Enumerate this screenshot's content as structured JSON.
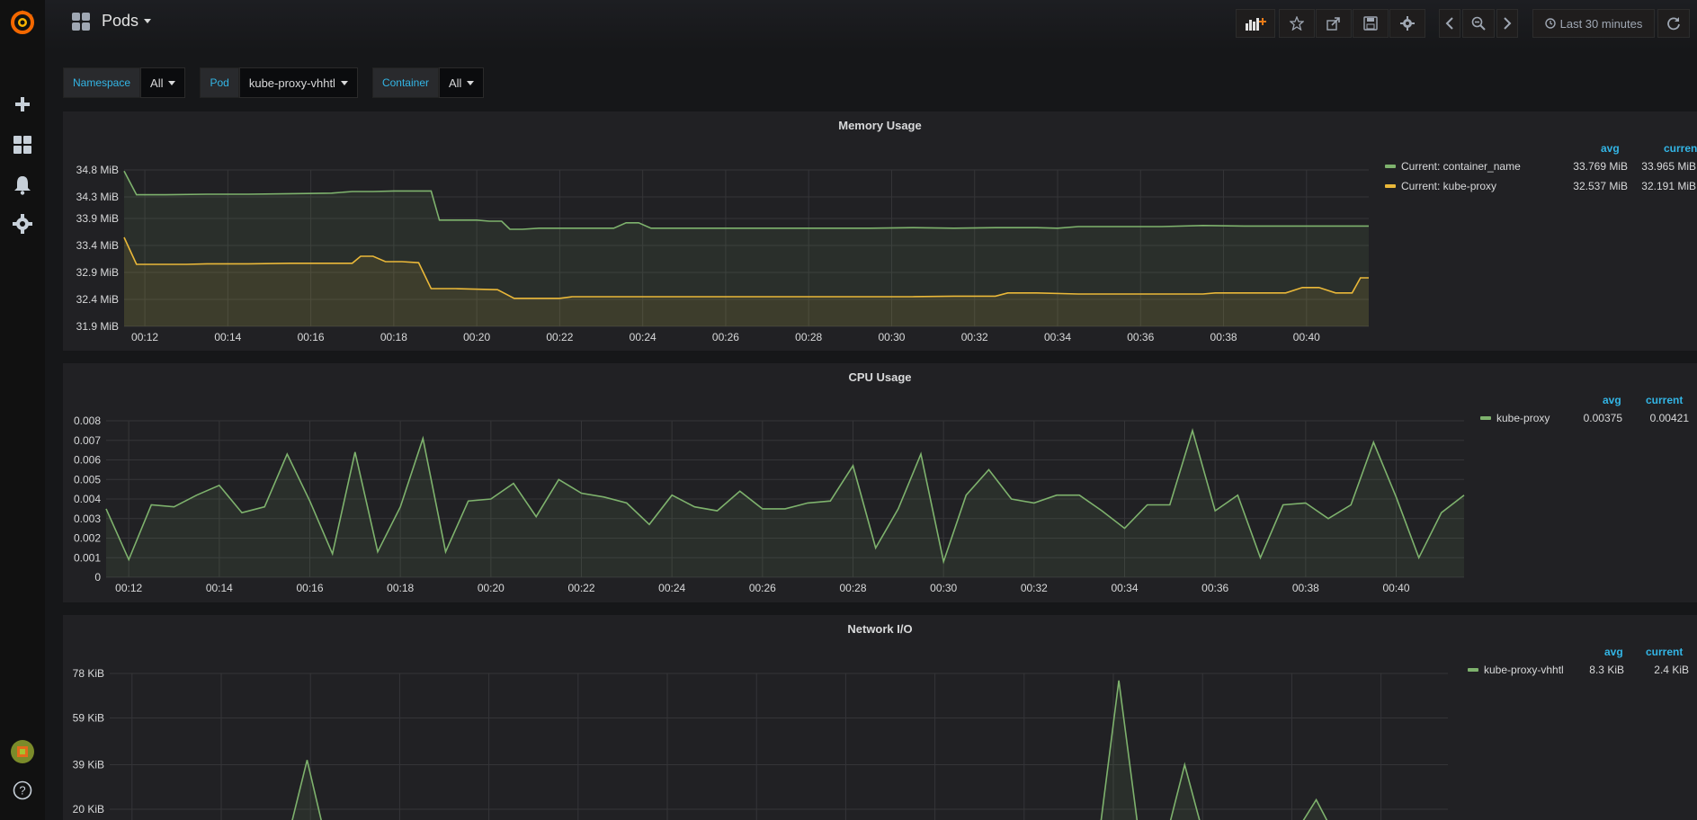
{
  "header": {
    "dashboard_title": "Pods",
    "time_range": "Last 30 minutes"
  },
  "toolbar": {
    "icons": [
      "add-panel-icon",
      "star-icon",
      "share-icon",
      "save-icon",
      "settings-icon",
      "chevron-left-icon",
      "zoom-out-icon",
      "chevron-right-icon",
      "clock-icon",
      "refresh-icon"
    ]
  },
  "sidebar": {
    "icons": [
      "grafana-logo-icon",
      "plus-icon",
      "dashboards-icon",
      "bell-icon",
      "gear-icon",
      "avatar",
      "help-icon"
    ]
  },
  "variables": [
    {
      "label": "Namespace",
      "value": "All"
    },
    {
      "label": "Pod",
      "value": "kube-proxy-vhhtl"
    },
    {
      "label": "Container",
      "value": "All"
    }
  ],
  "colors": {
    "green": "#7eb26d",
    "yellow": "#eab839",
    "accent": "#33b5e5",
    "panel_bg": "#212124",
    "page_bg": "#161719"
  },
  "chart_data": [
    {
      "type": "line",
      "title": "Memory Usage",
      "x_ticks": [
        "00:12",
        "00:14",
        "00:16",
        "00:18",
        "00:20",
        "00:22",
        "00:24",
        "00:26",
        "00:28",
        "00:30",
        "00:32",
        "00:34",
        "00:36",
        "00:38",
        "00:40"
      ],
      "y_ticks": [
        "31.9 MiB",
        "32.4 MiB",
        "32.9 MiB",
        "33.4 MiB",
        "33.9 MiB",
        "34.3 MiB",
        "34.8 MiB"
      ],
      "ylim": [
        31.9,
        34.8
      ],
      "x_range": [
        "00:11:30",
        "00:41:30"
      ],
      "legend_headers": {
        "avg": "avg",
        "current": "current"
      },
      "series": [
        {
          "name": "Current: container_name",
          "color": "#7eb26d",
          "avg": "33.769 MiB",
          "current": "33.965 MiB",
          "points": [
            [
              0,
              34.78
            ],
            [
              0.3,
              34.34
            ],
            [
              1,
              34.34
            ],
            [
              2,
              34.35
            ],
            [
              3,
              34.35
            ],
            [
              4,
              34.36
            ],
            [
              5,
              34.37
            ],
            [
              5.5,
              34.4
            ],
            [
              6,
              34.4
            ],
            [
              6.5,
              34.41
            ],
            [
              7,
              34.41
            ],
            [
              7.4,
              34.41
            ],
            [
              7.6,
              33.87
            ],
            [
              8.5,
              33.87
            ],
            [
              8.8,
              33.85
            ],
            [
              9.1,
              33.85
            ],
            [
              9.3,
              33.7
            ],
            [
              9.6,
              33.7
            ],
            [
              10,
              33.72
            ],
            [
              11,
              33.72
            ],
            [
              11.8,
              33.72
            ],
            [
              12.1,
              33.82
            ],
            [
              12.4,
              33.82
            ],
            [
              12.7,
              33.72
            ],
            [
              14,
              33.72
            ],
            [
              16,
              33.72
            ],
            [
              18,
              33.72
            ],
            [
              19,
              33.73
            ],
            [
              20,
              33.72
            ],
            [
              21,
              33.73
            ],
            [
              22,
              33.73
            ],
            [
              22.5,
              33.72
            ],
            [
              23,
              33.75
            ],
            [
              24,
              33.75
            ],
            [
              25,
              33.75
            ],
            [
              26,
              33.77
            ],
            [
              27,
              33.76
            ],
            [
              28,
              33.76
            ],
            [
              29,
              33.76
            ],
            [
              30,
              33.76
            ],
            [
              31,
              33.77
            ],
            [
              32,
              33.76
            ],
            [
              33,
              33.76
            ],
            [
              34,
              33.76
            ],
            [
              35,
              33.76
            ],
            [
              35.5,
              33.78
            ],
            [
              36,
              33.78
            ],
            [
              36.3,
              33.45
            ],
            [
              37,
              33.45
            ],
            [
              38,
              33.45
            ],
            [
              39,
              33.45
            ],
            [
              39.4,
              33.42
            ],
            [
              40,
              33.42
            ],
            [
              40.3,
              33.52
            ],
            [
              40.6,
              33.52
            ],
            [
              41,
              34.04
            ],
            [
              41.3,
              34.04
            ]
          ]
        },
        {
          "name": "Current: kube-proxy",
          "color": "#eab839",
          "avg": "32.537 MiB",
          "current": "32.191 MiB",
          "points": [
            [
              0,
              33.55
            ],
            [
              0.3,
              33.05
            ],
            [
              1,
              33.05
            ],
            [
              1.5,
              33.05
            ],
            [
              2,
              33.06
            ],
            [
              3,
              33.06
            ],
            [
              4,
              33.07
            ],
            [
              5,
              33.07
            ],
            [
              5.5,
              33.07
            ],
            [
              5.7,
              33.2
            ],
            [
              6,
              33.2
            ],
            [
              6.3,
              33.1
            ],
            [
              6.7,
              33.1
            ],
            [
              7.1,
              33.08
            ],
            [
              7.4,
              32.6
            ],
            [
              8,
              32.6
            ],
            [
              9,
              32.58
            ],
            [
              9.4,
              32.42
            ],
            [
              10,
              32.42
            ],
            [
              10.5,
              32.42
            ],
            [
              10.8,
              32.45
            ],
            [
              12,
              32.45
            ],
            [
              14,
              32.45
            ],
            [
              16,
              32.45
            ],
            [
              18,
              32.45
            ],
            [
              19,
              32.45
            ],
            [
              20,
              32.46
            ],
            [
              21,
              32.46
            ],
            [
              21.3,
              32.52
            ],
            [
              22,
              32.52
            ],
            [
              23,
              32.5
            ],
            [
              24,
              32.5
            ],
            [
              25,
              32.5
            ],
            [
              26,
              32.5
            ],
            [
              26.3,
              32.52
            ],
            [
              27,
              32.52
            ],
            [
              28,
              32.52
            ],
            [
              28.4,
              32.62
            ],
            [
              28.8,
              32.62
            ],
            [
              29.2,
              32.52
            ],
            [
              29.6,
              32.52
            ],
            [
              29.8,
              32.8
            ],
            [
              30.2,
              32.8
            ],
            [
              30.5,
              32.52
            ],
            [
              31,
              32.52
            ],
            [
              32,
              32.52
            ],
            [
              33,
              32.52
            ],
            [
              33.5,
              32.53
            ],
            [
              34,
              32.52
            ],
            [
              35,
              32.52
            ],
            [
              35.5,
              32.52
            ],
            [
              35.8,
              32.52
            ],
            [
              36.2,
              32.1
            ],
            [
              37,
              32.1
            ],
            [
              38,
              32.12
            ],
            [
              38.5,
              32.1
            ],
            [
              39,
              32.1
            ],
            [
              40,
              32.1
            ],
            [
              40.5,
              32.1
            ],
            [
              41,
              32.2
            ],
            [
              41.3,
              32.2
            ]
          ]
        }
      ]
    },
    {
      "type": "area",
      "title": "CPU Usage",
      "x_ticks": [
        "00:12",
        "00:14",
        "00:16",
        "00:18",
        "00:20",
        "00:22",
        "00:24",
        "00:26",
        "00:28",
        "00:30",
        "00:32",
        "00:34",
        "00:36",
        "00:38",
        "00:40"
      ],
      "y_ticks": [
        "0",
        "0.001",
        "0.002",
        "0.003",
        "0.004",
        "0.005",
        "0.006",
        "0.007",
        "0.008"
      ],
      "ylim": [
        0,
        0.008
      ],
      "x_range": [
        "00:11:30",
        "00:41:30"
      ],
      "legend_headers": {
        "avg": "avg",
        "current": "current"
      },
      "series": [
        {
          "name": "kube-proxy",
          "color": "#7eb26d",
          "avg": "0.00375",
          "current": "0.00421",
          "values": [
            0.0035,
            0.0009,
            0.0037,
            0.0036,
            0.0042,
            0.0047,
            0.0033,
            0.0036,
            0.0063,
            0.0039,
            0.0012,
            0.0064,
            0.0013,
            0.0036,
            0.0071,
            0.0013,
            0.0039,
            0.004,
            0.0048,
            0.0031,
            0.005,
            0.0043,
            0.0041,
            0.0038,
            0.0027,
            0.0042,
            0.0036,
            0.0034,
            0.0044,
            0.0035,
            0.0035,
            0.0038,
            0.0039,
            0.0057,
            0.0015,
            0.0035,
            0.0063,
            0.0008,
            0.0042,
            0.0055,
            0.004,
            0.0038,
            0.0042,
            0.0042,
            0.0034,
            0.0025,
            0.0037,
            0.0037,
            0.0075,
            0.0034,
            0.0042,
            0.001,
            0.0037,
            0.0038,
            0.003,
            0.0037,
            0.0069,
            0.0041,
            0.001,
            0.0033,
            0.0042
          ]
        }
      ]
    },
    {
      "type": "area",
      "title": "Network I/O",
      "x_ticks": [],
      "y_ticks": [
        "20 KiB",
        "39 KiB",
        "59 KiB",
        "78 KiB"
      ],
      "ylim": [
        0,
        78
      ],
      "x_range": [
        "00:11:30",
        "00:41:30"
      ],
      "legend_headers": {
        "avg": "avg",
        "current": "current"
      },
      "series": [
        {
          "name": "kube-proxy-vhhtl",
          "color": "#7eb26d",
          "avg": "8.3 KiB",
          "current": "2.4 KiB",
          "values": [
            4,
            7,
            5,
            2,
            5,
            3,
            8,
            7,
            3,
            41,
            1,
            2,
            8,
            2,
            2,
            5,
            8,
            4,
            3,
            2,
            8,
            2,
            2,
            4,
            3,
            5,
            3,
            9,
            1,
            9,
            3,
            4,
            5,
            1,
            5,
            2,
            2,
            1,
            9,
            5,
            6,
            1,
            2,
            5,
            4,
            1,
            75,
            3,
            2,
            39,
            4,
            4,
            4,
            3,
            9,
            24,
            6,
            5,
            8,
            11,
            10,
            6
          ]
        }
      ]
    }
  ]
}
